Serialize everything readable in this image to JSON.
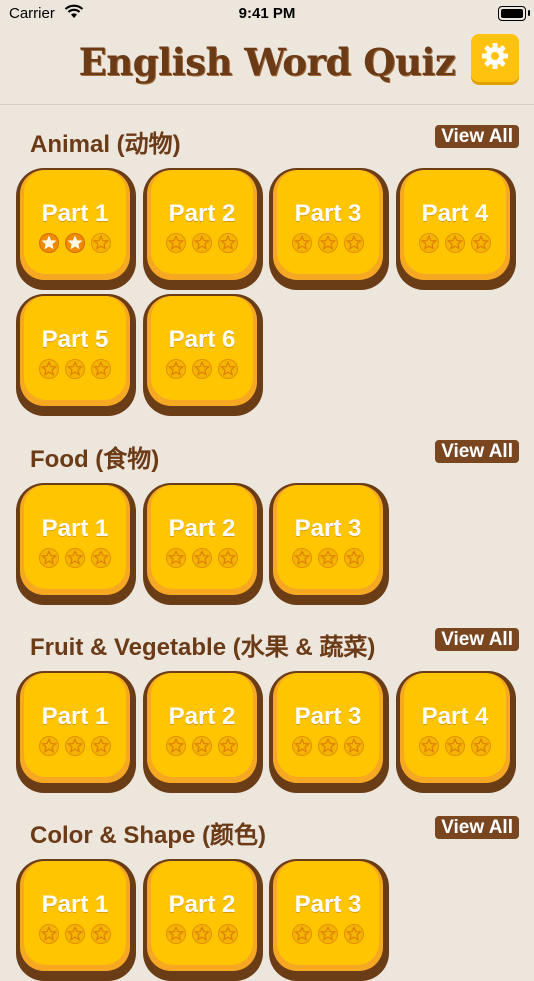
{
  "status_bar": {
    "carrier": "Carrier",
    "time": "9:41 PM"
  },
  "header": {
    "title": "English Word Quiz"
  },
  "sections": [
    {
      "title": "Animal (动物)",
      "view_all": "View All",
      "parts": [
        {
          "label": "Part 1",
          "stars_earned": 2
        },
        {
          "label": "Part 2",
          "stars_earned": 0
        },
        {
          "label": "Part 3",
          "stars_earned": 0
        },
        {
          "label": "Part 4",
          "stars_earned": 0
        },
        {
          "label": "Part 5",
          "stars_earned": 0
        },
        {
          "label": "Part 6",
          "stars_earned": 0
        }
      ]
    },
    {
      "title": "Food (食物)",
      "view_all": "View All",
      "parts": [
        {
          "label": "Part 1",
          "stars_earned": 0
        },
        {
          "label": "Part 2",
          "stars_earned": 0
        },
        {
          "label": "Part 3",
          "stars_earned": 0
        }
      ]
    },
    {
      "title": "Fruit & Vegetable (水果 & 蔬菜)",
      "view_all": "View All",
      "parts": [
        {
          "label": "Part 1",
          "stars_earned": 0
        },
        {
          "label": "Part 2",
          "stars_earned": 0
        },
        {
          "label": "Part 3",
          "stars_earned": 0
        },
        {
          "label": "Part 4",
          "stars_earned": 0
        }
      ]
    },
    {
      "title": "Color & Shape (颜色)",
      "view_all": "View All",
      "parts": [
        {
          "label": "Part 1",
          "stars_earned": 0
        },
        {
          "label": "Part 2",
          "stars_earned": 0
        },
        {
          "label": "Part 3",
          "stars_earned": 0
        }
      ]
    }
  ],
  "colors": {
    "background": "#ece6dc",
    "title_brown": "#6b3a16",
    "card_yellow": "#ffc500",
    "card_outline": "#6b3d17",
    "view_all_bg": "#7a4620",
    "settings_yellow": "#ffc20e"
  },
  "icons": {
    "settings": "gear-icon",
    "star": "star-icon",
    "wifi": "wifi-icon",
    "battery": "battery-icon"
  }
}
